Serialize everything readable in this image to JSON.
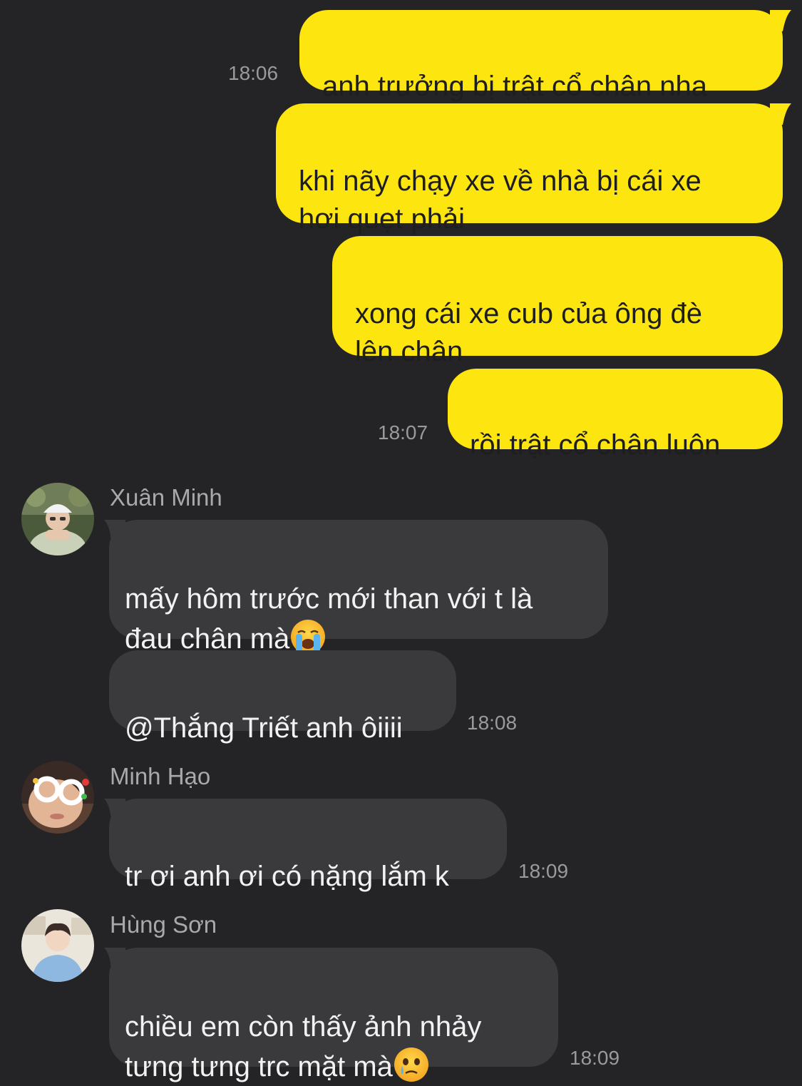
{
  "colors": {
    "background": "#242426",
    "outgoing_bubble": "#fde610",
    "incoming_bubble": "#3a3a3c",
    "timestamp": "#9a9a9c",
    "sender_name": "#a9a9ab"
  },
  "outgoing": [
    {
      "text": "anh trưởng bị trật cổ chân nha",
      "time": "18:06"
    },
    {
      "text": "khi nãy chạy xe về nhà bị cái xe\nhơi quẹt phải"
    },
    {
      "text": "xong cái xe cub của ông đè\nlên chân"
    },
    {
      "text": "rồi trật cổ chân luôn",
      "time": "18:07"
    }
  ],
  "groups": [
    {
      "sender": "Xuân Minh",
      "avatar_icon": "avatar-girl-with-hat-icon",
      "messages": [
        {
          "text": "mấy hôm trước mới than với t là\nđau chân mà",
          "emoji": "loudly-crying-face-icon"
        },
        {
          "text": "@Thắng Triết anh ôiiii",
          "time": "18:08"
        }
      ]
    },
    {
      "sender": "Minh Hạo",
      "avatar_icon": "avatar-person-with-glasses-icon",
      "messages": [
        {
          "text": "tr ơi anh ơi có nặng lắm k",
          "time": "18:09"
        }
      ]
    },
    {
      "sender": "Hùng Sơn",
      "avatar_icon": "avatar-boy-blue-hoodie-icon",
      "messages": [
        {
          "text": "chiều em còn thấy ảnh nhảy\ntưng tưng trc mặt mà",
          "emoji": "face-holding-back-tears-icon",
          "time": "18:09"
        }
      ]
    }
  ]
}
